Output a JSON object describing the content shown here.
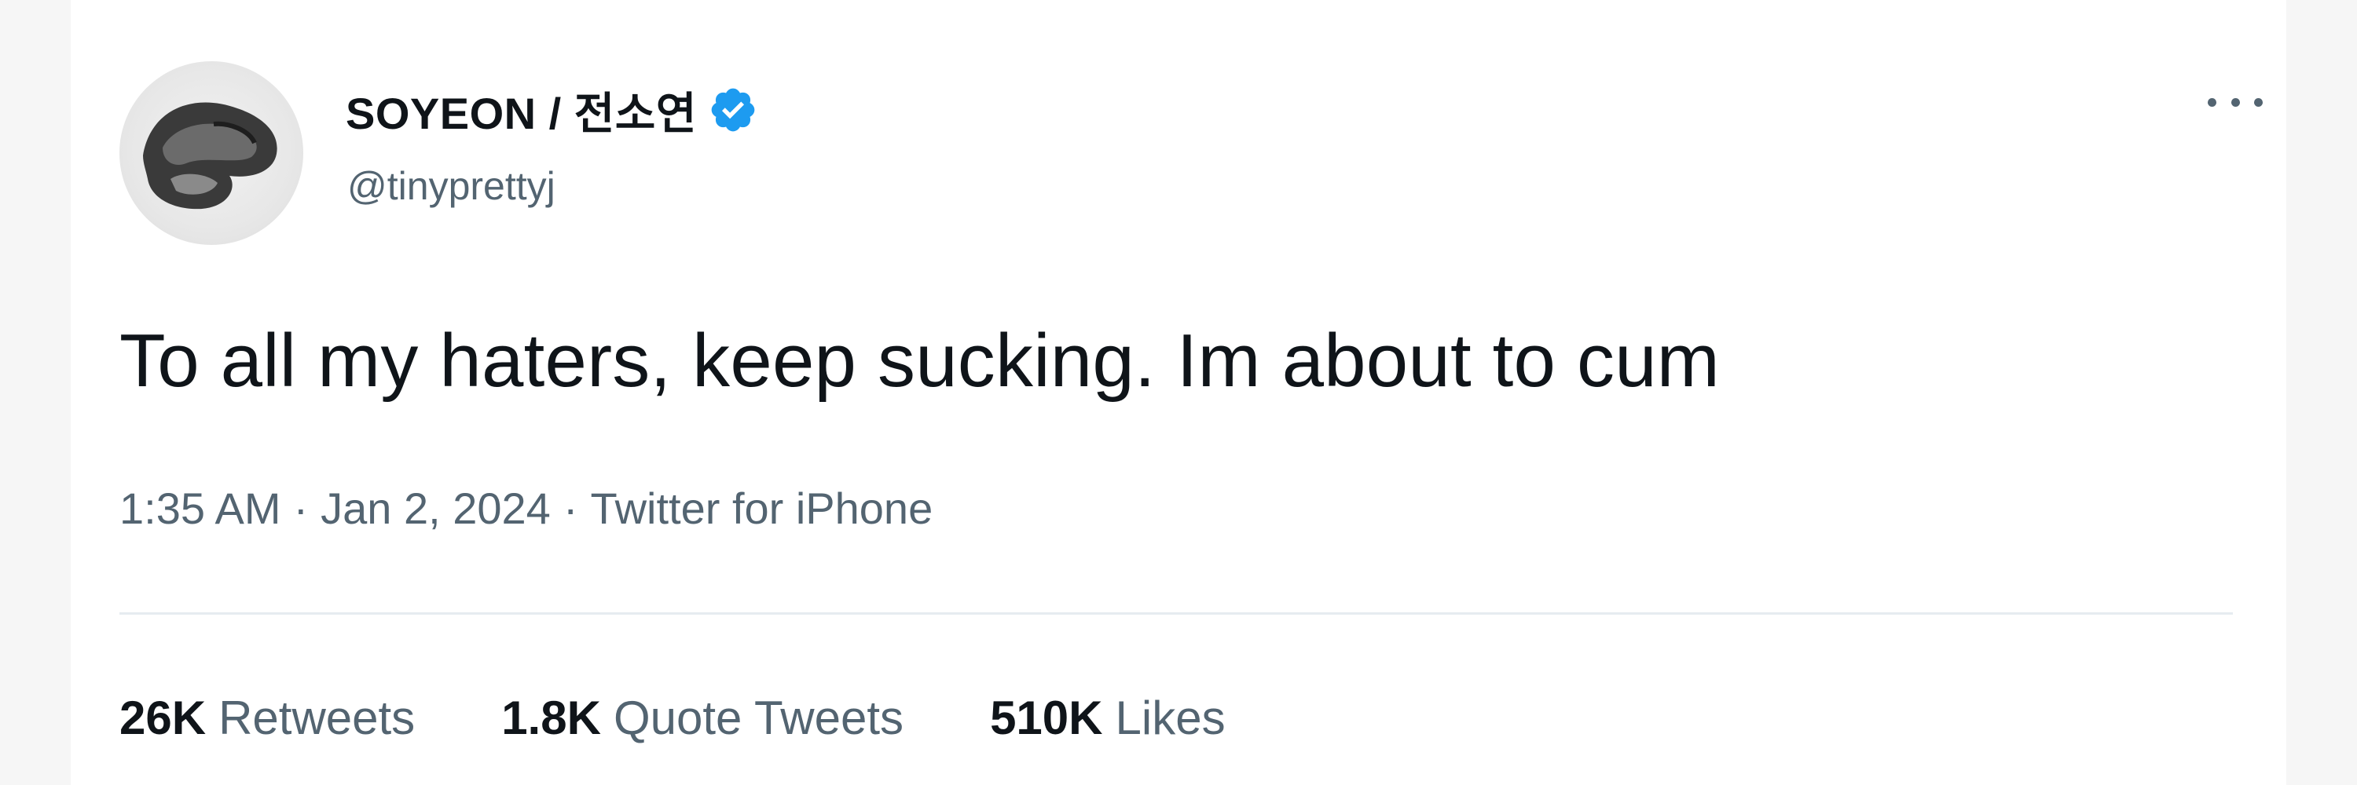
{
  "author": {
    "display_name": "SOYEON / 전소연",
    "handle": "@tinyprettyj",
    "verified": true
  },
  "tweet": {
    "text": "To all my haters, keep sucking. Im about to cum",
    "time": "1:35 AM",
    "date": "Jan 2, 2024",
    "source": "Twitter for iPhone",
    "separator": "·"
  },
  "stats": [
    {
      "count": "26K",
      "label": "Retweets"
    },
    {
      "count": "1.8K",
      "label": "Quote Tweets"
    },
    {
      "count": "510K",
      "label": "Likes"
    }
  ],
  "icons": {
    "more": "more-horizontal-icon",
    "verified": "verified-badge-icon"
  },
  "colors": {
    "verified_blue": "#1d9bf0",
    "primary_text": "#0f1419",
    "secondary_text": "#536471",
    "divider": "#e6ecf0"
  }
}
